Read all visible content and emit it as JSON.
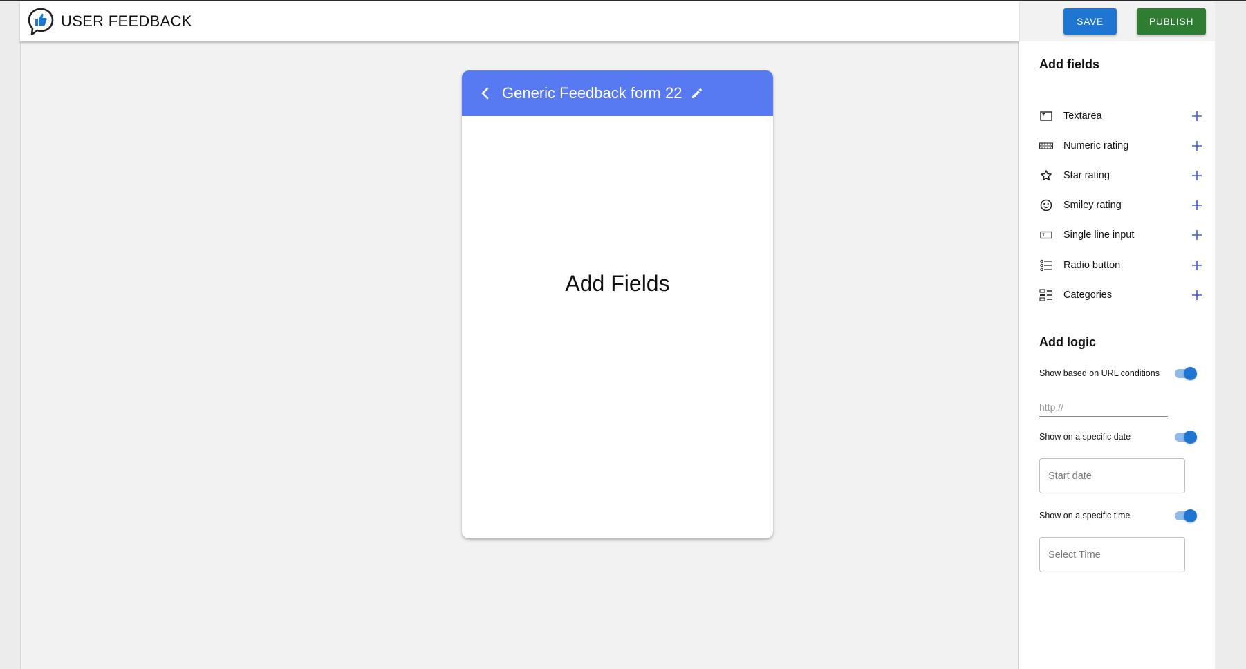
{
  "app": {
    "title": "USER FEEDBACK"
  },
  "toolbar": {
    "save_label": "SAVE",
    "publish_label": "PUBLISH"
  },
  "colors": {
    "header_blue": "#5779f2",
    "save_blue": "#1e75d2",
    "publish_green": "#2e7d32",
    "toggle_on": "#1e75d2"
  },
  "form": {
    "title": "Generic Feedback form 22",
    "empty_text": "Add Fields"
  },
  "panel": {
    "add_fields_title": "Add fields",
    "fields": [
      {
        "label": "Textarea",
        "icon": "textarea-icon"
      },
      {
        "label": "Numeric rating",
        "icon": "numeric-rating-icon"
      },
      {
        "label": "Star rating",
        "icon": "star-icon"
      },
      {
        "label": "Smiley rating",
        "icon": "smiley-icon"
      },
      {
        "label": "Single line input",
        "icon": "single-line-input-icon"
      },
      {
        "label": "Radio button",
        "icon": "radio-list-icon"
      },
      {
        "label": "Categories",
        "icon": "categories-icon"
      }
    ],
    "add_logic_title": "Add logic",
    "logic": {
      "url_label": "Show based on URL conditions",
      "url_toggle_on": true,
      "url_placeholder": "http://",
      "date_label": "Show on a specific date",
      "date_toggle_on": true,
      "start_date_placeholder": "Start date",
      "time_label": "Show on a specific time",
      "time_toggle_on": true,
      "time_placeholder": "Select Time"
    }
  }
}
